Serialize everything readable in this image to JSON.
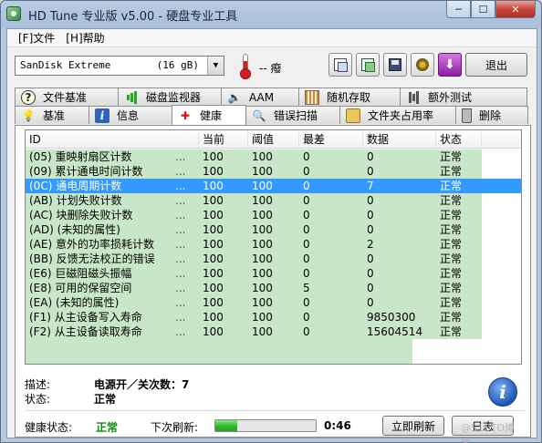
{
  "window": {
    "title": "HD Tune 专业版 v5.00 - 硬盘专业工具",
    "controls": {
      "minimize": "─",
      "maximize": "☐",
      "close": "✕"
    }
  },
  "menu": {
    "items": [
      {
        "label": "[F]文件"
      },
      {
        "label": "[H]帮助"
      }
    ]
  },
  "toolbar": {
    "drive_name": "SanDisk Extreme",
    "drive_capacity": "(16 gB)",
    "temperature": "-- 癈",
    "exit_label": "退出",
    "icons": [
      "copy-info-icon",
      "copy-screenshot-icon",
      "save-icon",
      "options-icon",
      "download-icon"
    ]
  },
  "tabs": {
    "row1": [
      {
        "label": "文件基准",
        "icon": "file-benchmark-icon"
      },
      {
        "label": "磁盘监视器",
        "icon": "disk-monitor-icon"
      },
      {
        "label": "AAM",
        "icon": "speaker-icon"
      },
      {
        "label": "随机存取",
        "icon": "random-access-icon"
      },
      {
        "label": "额外测试",
        "icon": "extra-tests-icon"
      }
    ],
    "row2": [
      {
        "label": "基准",
        "icon": "benchmark-icon"
      },
      {
        "label": "信息",
        "icon": "info-icon"
      },
      {
        "label": "健康",
        "icon": "health-icon",
        "active": true
      },
      {
        "label": "错误扫描",
        "icon": "error-scan-icon"
      },
      {
        "label": "文件夹占用率",
        "icon": "folder-usage-icon"
      },
      {
        "label": "删除",
        "icon": "erase-icon"
      }
    ]
  },
  "smart_table": {
    "columns": [
      "ID",
      "当前",
      "阈值",
      "最差",
      "数据",
      "状态"
    ],
    "rows": [
      {
        "id": "(05) 重映射扇区计数",
        "current": "100",
        "threshold": "100",
        "worst": "0",
        "data": "0",
        "status": "正常"
      },
      {
        "id": "(09) 累计通电时间计数",
        "current": "100",
        "threshold": "100",
        "worst": "0",
        "data": "0",
        "status": "正常"
      },
      {
        "id": "(0C) 通电周期计数",
        "current": "100",
        "threshold": "100",
        "worst": "0",
        "data": "7",
        "status": "正常",
        "selected": true
      },
      {
        "id": "(AB) 计划失败计数",
        "current": "100",
        "threshold": "100",
        "worst": "0",
        "data": "0",
        "status": "正常"
      },
      {
        "id": "(AC) 块删除失败计数",
        "current": "100",
        "threshold": "100",
        "worst": "0",
        "data": "0",
        "status": "正常"
      },
      {
        "id": "(AD) (未知的属性)",
        "current": "100",
        "threshold": "100",
        "worst": "0",
        "data": "0",
        "status": "正常"
      },
      {
        "id": "(AE) 意外的功率损耗计数",
        "current": "100",
        "threshold": "100",
        "worst": "0",
        "data": "2",
        "status": "正常"
      },
      {
        "id": "(BB) 反馈无法校正的错误",
        "current": "100",
        "threshold": "100",
        "worst": "0",
        "data": "0",
        "status": "正常"
      },
      {
        "id": "(E6) 巨磁阻磁头振幅",
        "current": "100",
        "threshold": "100",
        "worst": "0",
        "data": "0",
        "status": "正常"
      },
      {
        "id": "(E8) 可用的保留空间",
        "current": "100",
        "threshold": "100",
        "worst": "5",
        "data": "0",
        "status": "正常"
      },
      {
        "id": "(EA) (未知的属性)",
        "current": "100",
        "threshold": "100",
        "worst": "0",
        "data": "0",
        "status": "正常"
      },
      {
        "id": "(F1) 从主设备写入寿命",
        "current": "100",
        "threshold": "100",
        "worst": "0",
        "data": "9850300",
        "status": "正常"
      },
      {
        "id": "(F2) 从主设备读取寿命",
        "current": "100",
        "threshold": "100",
        "worst": "0",
        "data": "15604514",
        "status": "正常"
      }
    ]
  },
  "details": {
    "description_label": "描述:",
    "description_value": "电源开／关次数：7",
    "status_label": "状态:",
    "status_value": "正常"
  },
  "statusbar": {
    "health_label": "健康状态:",
    "health_value": "正常",
    "next_refresh_label": "下次刷新:",
    "refresh_progress": 0.22,
    "countdown": "0:46",
    "refresh_button": "立即刷新",
    "log_button": "日志",
    "watermark": "@51CTO博客"
  },
  "colors": {
    "row_bg": "#c8e6c8",
    "selected_bg": "#3399ff",
    "health_ok": "#0a8a0a",
    "progress_fill": "#2fbf2f"
  }
}
